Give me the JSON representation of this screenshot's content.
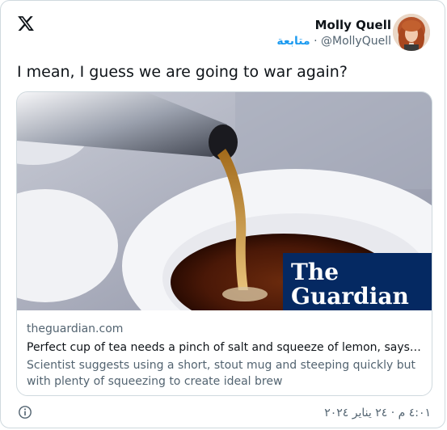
{
  "author": {
    "name": "Molly Quell",
    "handle": "@MollyQuell",
    "separator": "·",
    "follow_label": "متابعة"
  },
  "tweet": {
    "text": "I mean, I guess we are going to war again?"
  },
  "link_card": {
    "domain": "theguardian.com",
    "headline": "Perfect cup of tea needs a pinch of salt and squeeze of lemon, says US ...",
    "description": "Scientist suggests using a short, stout mug and steeping quickly but with plenty of squeezing to create ideal brew",
    "logo_line1": "The",
    "logo_line2": "Guardian",
    "logo_bg": "#052962"
  },
  "footer": {
    "timestamp": "٤:٠١ م · ٢٤ يناير ٢٠٢٤"
  },
  "colors": {
    "accent": "#1d9bf0",
    "muted": "#536471",
    "border": "#cfd9de"
  },
  "icons": [
    "x-logo-icon",
    "info-icon"
  ]
}
